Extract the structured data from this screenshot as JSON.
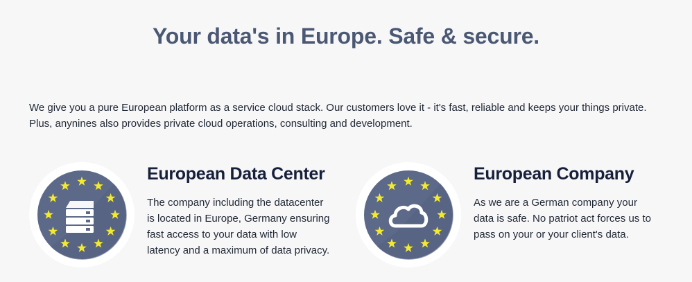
{
  "page": {
    "title": "Your data's in Europe. Safe & secure."
  },
  "intro": {
    "lines": [
      "We give you a pure European platform as a service cloud stack. Our customers love it - it's fast, reliable and keeps your things private.",
      "Plus, anynines also provides private cloud operations, consulting and development."
    ]
  },
  "features": [
    {
      "heading": "European Data Center",
      "icon": "server-icon",
      "body_lines": [
        "The company including the datacenter",
        "is located in Europe, Germany ensuring",
        "fast access to your data with low",
        "latency and a maximum of data privacy."
      ]
    },
    {
      "heading": "European Company",
      "icon": "cloud-icon",
      "body_lines": [
        "As we are a German company your",
        "data is safe. No patriot act forces us to",
        "pass on your or your client's data."
      ]
    }
  ],
  "colors": {
    "title": "#4b5873",
    "badge_disc": "#5c6989",
    "stars": "#f3ea2e",
    "icon_white": "#ffffff"
  }
}
